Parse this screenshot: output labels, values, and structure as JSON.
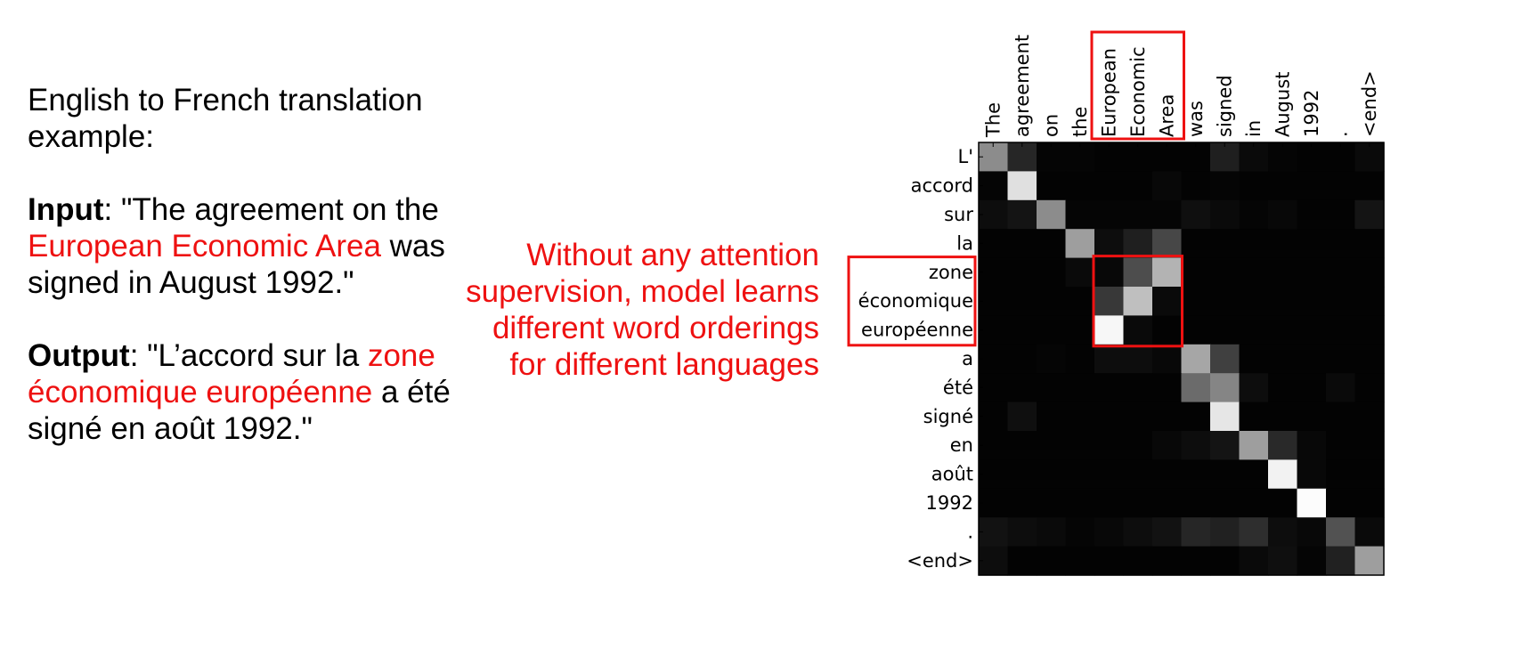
{
  "slide": {
    "intro": "English to French translation example:",
    "input_label": "Input",
    "input_pre": ": \"The agreement on the ",
    "input_highlight": "European Economic Area",
    "input_post": " was signed in August 1992.\"",
    "output_label": "Output",
    "output_pre": ": \"L’accord sur la ",
    "output_highlight": "zone économique européenne",
    "output_post": " a été signé en août 1992.\"",
    "note": "Without any attention supervision, model learns different word orderings for different languages",
    "highlight_color": "#ee1111"
  },
  "chart_data": {
    "type": "heatmap",
    "title": "",
    "x_labels": [
      "The",
      "agreement",
      "on",
      "the",
      "European",
      "Economic",
      "Area",
      "was",
      "signed",
      "in",
      "August",
      "1992",
      ".",
      "<end>"
    ],
    "y_labels": [
      "L'",
      "accord",
      "sur",
      "la",
      "zone",
      "économique",
      "européenne",
      "a",
      "été",
      "signé",
      "en",
      "août",
      "1992",
      ".",
      "<end>"
    ],
    "colorscale": "grayscale (black = 0, white = 1)",
    "values": [
      [
        0.55,
        0.15,
        0.02,
        0.02,
        0.01,
        0.01,
        0.01,
        0.01,
        0.12,
        0.04,
        0.02,
        0.01,
        0.01,
        0.04
      ],
      [
        0.02,
        0.88,
        0.01,
        0.01,
        0.01,
        0.01,
        0.03,
        0.01,
        0.02,
        0.01,
        0.01,
        0.01,
        0.01,
        0.01
      ],
      [
        0.05,
        0.08,
        0.55,
        0.02,
        0.02,
        0.02,
        0.02,
        0.06,
        0.04,
        0.02,
        0.03,
        0.01,
        0.01,
        0.08
      ],
      [
        0.01,
        0.01,
        0.01,
        0.62,
        0.05,
        0.12,
        0.28,
        0.01,
        0.01,
        0.01,
        0.01,
        0.01,
        0.01,
        0.01
      ],
      [
        0.01,
        0.01,
        0.01,
        0.04,
        0.03,
        0.3,
        0.7,
        0.01,
        0.01,
        0.01,
        0.01,
        0.01,
        0.01,
        0.01
      ],
      [
        0.01,
        0.01,
        0.01,
        0.01,
        0.22,
        0.75,
        0.04,
        0.01,
        0.01,
        0.01,
        0.01,
        0.01,
        0.01,
        0.01
      ],
      [
        0.01,
        0.01,
        0.01,
        0.01,
        0.97,
        0.04,
        0.01,
        0.01,
        0.01,
        0.01,
        0.01,
        0.01,
        0.01,
        0.01
      ],
      [
        0.01,
        0.01,
        0.02,
        0.01,
        0.05,
        0.05,
        0.03,
        0.65,
        0.25,
        0.01,
        0.01,
        0.01,
        0.01,
        0.01
      ],
      [
        0.01,
        0.01,
        0.01,
        0.01,
        0.01,
        0.01,
        0.01,
        0.42,
        0.52,
        0.05,
        0.01,
        0.01,
        0.04,
        0.01
      ],
      [
        0.01,
        0.06,
        0.01,
        0.01,
        0.01,
        0.01,
        0.01,
        0.01,
        0.9,
        0.01,
        0.01,
        0.01,
        0.01,
        0.01
      ],
      [
        0.01,
        0.01,
        0.01,
        0.01,
        0.01,
        0.01,
        0.03,
        0.05,
        0.08,
        0.62,
        0.16,
        0.03,
        0.01,
        0.01
      ],
      [
        0.01,
        0.01,
        0.01,
        0.01,
        0.01,
        0.01,
        0.01,
        0.01,
        0.01,
        0.01,
        0.95,
        0.03,
        0.01,
        0.01
      ],
      [
        0.01,
        0.01,
        0.01,
        0.01,
        0.01,
        0.01,
        0.01,
        0.01,
        0.01,
        0.01,
        0.01,
        0.99,
        0.01,
        0.01
      ],
      [
        0.07,
        0.05,
        0.04,
        0.02,
        0.03,
        0.05,
        0.07,
        0.15,
        0.13,
        0.18,
        0.05,
        0.03,
        0.32,
        0.04
      ],
      [
        0.05,
        0.01,
        0.01,
        0.01,
        0.01,
        0.01,
        0.01,
        0.01,
        0.01,
        0.04,
        0.06,
        0.02,
        0.13,
        0.62
      ]
    ],
    "highlight_color": "#ee1111",
    "highlighted_x": [
      "European",
      "Economic",
      "Area"
    ],
    "highlighted_y": [
      "zone",
      "économique",
      "européenne"
    ]
  }
}
